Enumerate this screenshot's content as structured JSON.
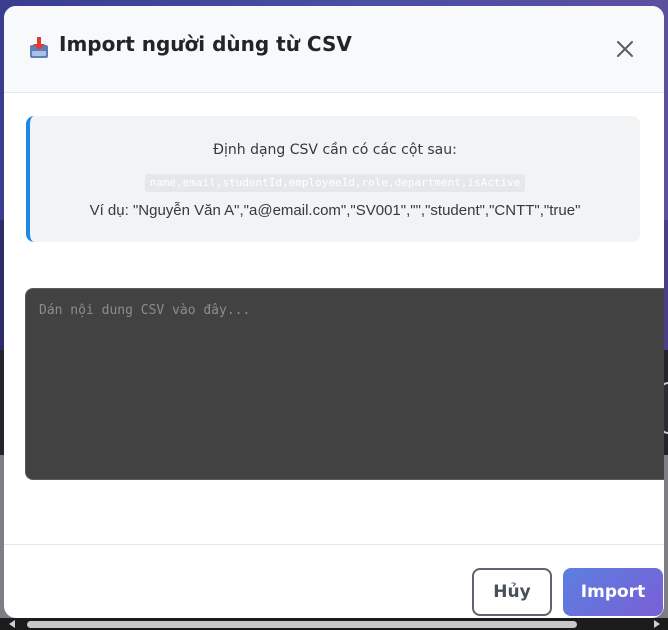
{
  "modal": {
    "title": "Import người dùng từ CSV",
    "title_icon": "inbox-tray-icon",
    "close_icon": "close-icon"
  },
  "info": {
    "heading": "Định dạng CSV cần có các cột sau:",
    "columns_code": "name,email,studentId,employeeId,role,department,isActive",
    "example": "Ví dụ: \"Nguyễn Văn A\",\"a@email.com\",\"SV001\",\"\",\"student\",\"CNTT\",\"true\""
  },
  "textarea": {
    "placeholder": "Dán nội dung CSV vào đây...",
    "value": ""
  },
  "buttons": {
    "cancel_label": "Hủy",
    "import_label": "Import"
  },
  "colors": {
    "accent_border": "#1e88e5",
    "import_gradient_start": "#5b7fe0",
    "import_gradient_end": "#7a5fd6",
    "textarea_bg": "#424242"
  }
}
